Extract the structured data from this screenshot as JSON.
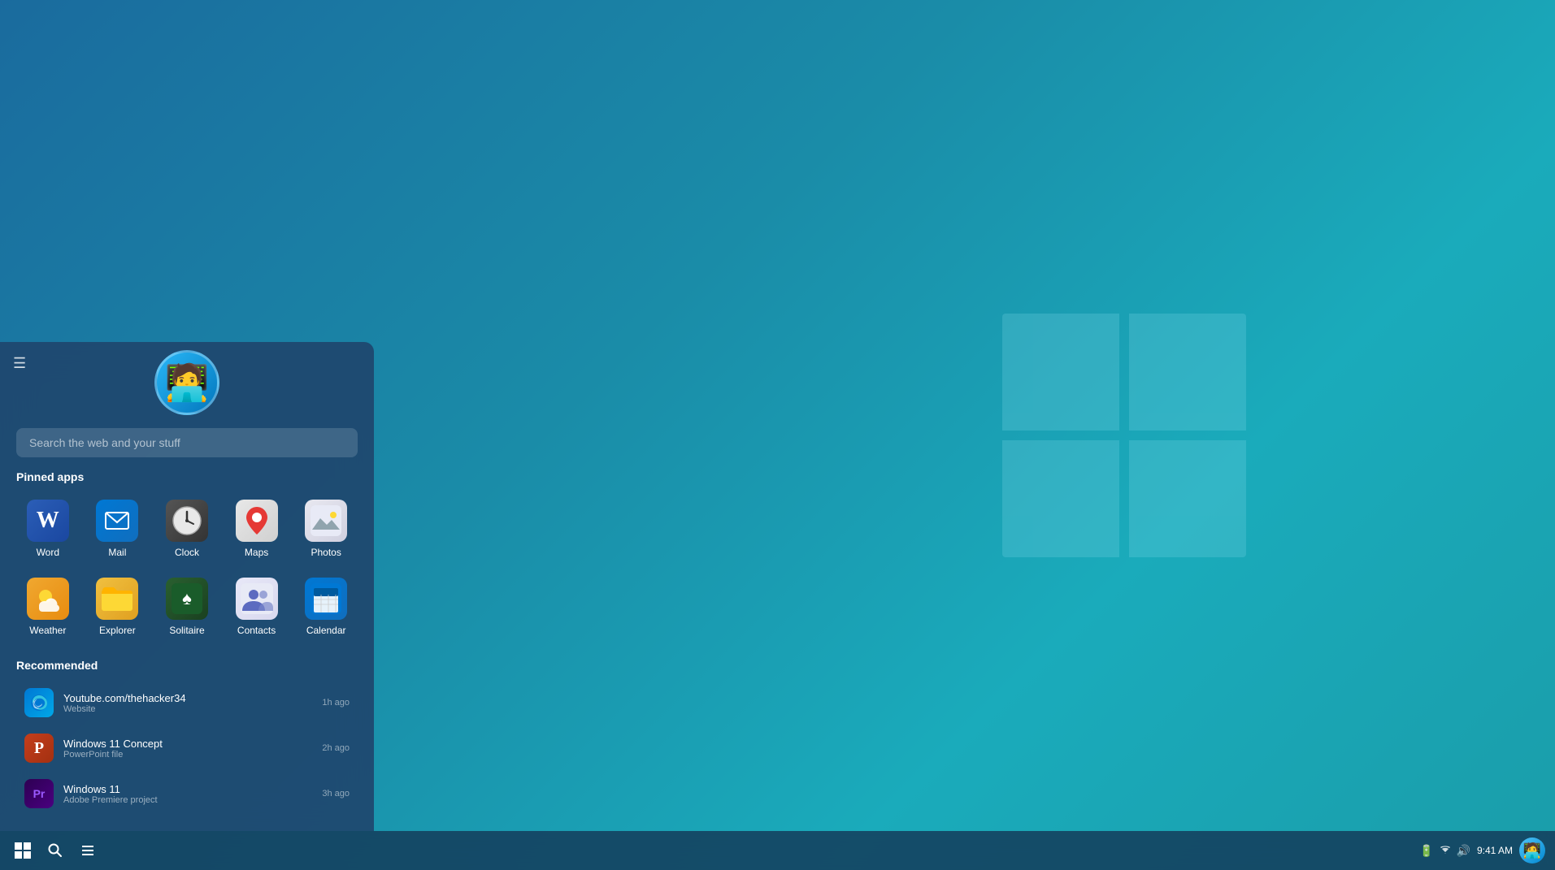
{
  "desktop": {
    "background_color": "#1a8ca8"
  },
  "taskbar": {
    "start_label": "⊞",
    "search_label": "🔍",
    "widgets_label": "≡",
    "time": "9:41 AM",
    "tray": {
      "battery_icon": "battery",
      "wifi_icon": "wifi",
      "volume_icon": "volume"
    }
  },
  "start_menu": {
    "hamburger": "☰",
    "search_placeholder": "Search the web and your stuff",
    "pinned_title": "Pinned apps",
    "recommended_title": "Recommended",
    "pinned_apps": [
      {
        "id": "word",
        "label": "Word",
        "icon_class": "icon-word",
        "icon_symbol": "W"
      },
      {
        "id": "mail",
        "label": "Mail",
        "icon_class": "icon-mail",
        "icon_symbol": "✉"
      },
      {
        "id": "clock",
        "label": "Clock",
        "icon_class": "icon-clock",
        "icon_symbol": "🕐"
      },
      {
        "id": "maps",
        "label": "Maps",
        "icon_class": "icon-maps",
        "icon_symbol": "📍"
      },
      {
        "id": "photos",
        "label": "Photos",
        "icon_class": "icon-photos",
        "icon_symbol": "🖼"
      },
      {
        "id": "weather",
        "label": "Weather",
        "icon_class": "icon-weather",
        "icon_symbol": "🌤"
      },
      {
        "id": "explorer",
        "label": "Explorer",
        "icon_class": "icon-explorer",
        "icon_symbol": "📁"
      },
      {
        "id": "solitaire",
        "label": "Solitaire",
        "icon_class": "icon-solitaire",
        "icon_symbol": "♠"
      },
      {
        "id": "contacts",
        "label": "Contacts",
        "icon_class": "icon-contacts",
        "icon_symbol": "👥"
      },
      {
        "id": "calendar",
        "label": "Calendar",
        "icon_class": "icon-calendar",
        "icon_symbol": "📅"
      }
    ],
    "recommended": [
      {
        "id": "rec1",
        "title": "Youtube.com/thehacker34",
        "subtitle": "Website",
        "time": "1h ago",
        "icon_color": "#0078d4",
        "icon_symbol": "E"
      },
      {
        "id": "rec2",
        "title": "Windows 11 Concept",
        "subtitle": "PowerPoint file",
        "time": "2h ago",
        "icon_color": "#c43e1c",
        "icon_symbol": "P"
      },
      {
        "id": "rec3",
        "title": "Windows 11",
        "subtitle": "Adobe Premiere project",
        "time": "3h ago",
        "icon_color": "#9b59b6",
        "icon_symbol": "Pr"
      }
    ]
  }
}
